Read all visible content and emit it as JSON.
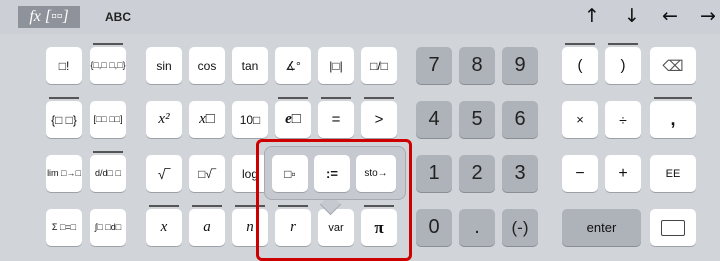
{
  "tabs": {
    "fx": "fx [▫▫]",
    "abc": "ABC"
  },
  "arrows": {
    "up": "↑",
    "down": "↓",
    "left": "←",
    "right": "→"
  },
  "row1": [
    "□!",
    "{□,□ □,□}",
    "sin",
    "cos",
    "tan",
    "∡°",
    "|□|",
    "□/□"
  ],
  "row2": [
    "{□ □}",
    "[□□ □□]",
    "x²",
    "x□",
    "10□",
    "e□",
    "=",
    ">"
  ],
  "row3": [
    "lim □→□",
    "d/d□ □",
    "√‾",
    "□√‾",
    "log"
  ],
  "row4": [
    "Σ □=□",
    "∫□ □d□",
    "x",
    "a",
    "n",
    "r",
    "var",
    "π"
  ],
  "popup": [
    "□▫",
    ":=",
    "sto→"
  ],
  "numpad": {
    "r1": [
      "7",
      "8",
      "9"
    ],
    "r2": [
      "4",
      "5",
      "6"
    ],
    "r3": [
      "1",
      "2",
      "3"
    ],
    "r4": [
      "0",
      ".",
      "(-)"
    ]
  },
  "ops": {
    "r1": [
      "(",
      ")",
      "⌫"
    ],
    "r2": [
      "×",
      "÷",
      ","
    ],
    "r3": [
      "−",
      "+",
      "EE"
    ],
    "enter": "enter",
    "keyboard_icon": "keyboard-dismiss-icon"
  }
}
